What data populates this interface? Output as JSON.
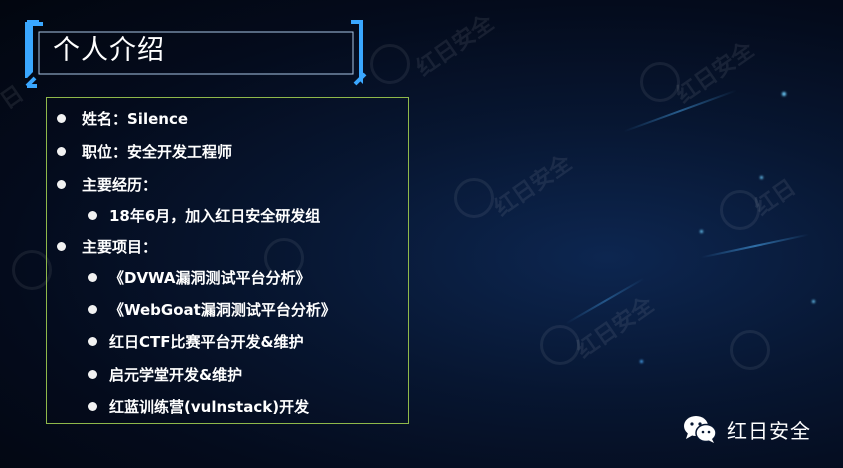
{
  "slide": {
    "title": "个人介绍",
    "items": [
      {
        "text": "姓名：Silence",
        "level": 1
      },
      {
        "text": "职位：安全开发工程师",
        "level": 1
      },
      {
        "text": "主要经历：",
        "level": 1
      },
      {
        "text": "18年6月，加入红日安全研发组",
        "level": 2
      },
      {
        "text": "主要项目：",
        "level": 1
      },
      {
        "text": "《DVWA漏洞测试平台分析》",
        "level": 2
      },
      {
        "text": "《WebGoat漏洞测试平台分析》",
        "level": 2
      },
      {
        "text": "红日CTF比赛平台开发&维护",
        "level": 2
      },
      {
        "text": "启元学堂开发&维护",
        "level": 2
      },
      {
        "text": "红蓝训练营(vulnstack)开发",
        "level": 2
      }
    ]
  },
  "brand": {
    "label": "红日安全",
    "icon": "wechat-icon"
  },
  "colors": {
    "frame_accent": "#3aa7ff",
    "box_border": "#8fb84a",
    "background": "#071631"
  }
}
